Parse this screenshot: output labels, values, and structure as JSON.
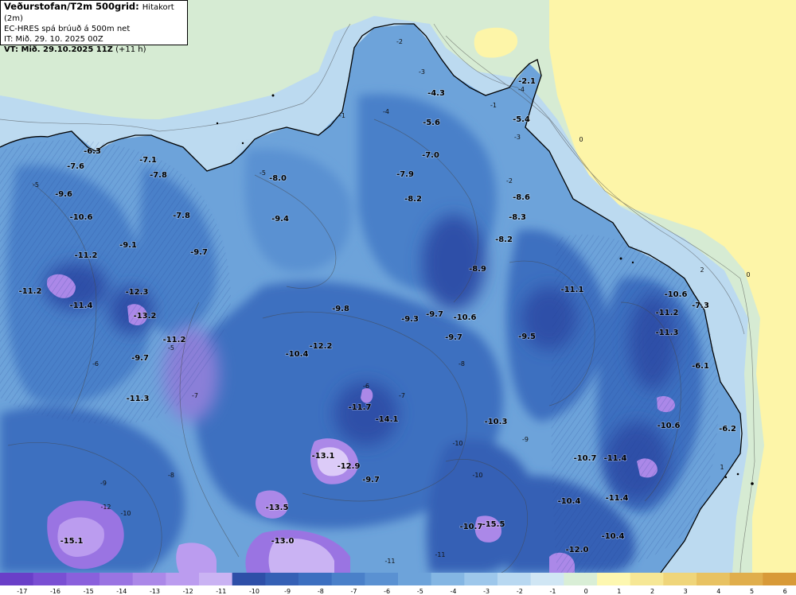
{
  "header": {
    "title": "Veðurstofan/T2m 500grid:",
    "title_sub": "Hitakort (2m)",
    "model_line": "EC-HRES spá brúuð á 500m net",
    "init_line": "IT: Mið. 29. 10. 2025 00Z",
    "valid_bold": "VT: Mið. 29.10.2025 11Z",
    "valid_rest": "(+11 h)"
  },
  "colors": {
    "ocean_sea": "#d6ebd3",
    "coastal_warm": "#fdf5a8",
    "contour_line": "#444444",
    "coastline": "#000000"
  },
  "colorbar": {
    "ticks": [
      "-17",
      "-16",
      "-15",
      "-14",
      "-13",
      "-12",
      "-11",
      "-10",
      "-9",
      "-8",
      "-7",
      "-6",
      "-5",
      "-4",
      "-3",
      "-2",
      "-1",
      "0",
      "1",
      "2",
      "3",
      "4",
      "5",
      "6"
    ],
    "colors": [
      "#6a3fc8",
      "#7a4fd3",
      "#8a60dc",
      "#9a74e2",
      "#ab88e8",
      "#bb9cef",
      "#cab3f3",
      "#2e4fa8",
      "#3560b5",
      "#3c6fc0",
      "#4a80c9",
      "#5a91d2",
      "#6da3da",
      "#84b6e3",
      "#9dc7eb",
      "#b8d8f1",
      "#d0e6f4",
      "#d9eed6",
      "#fdf7b0",
      "#f6e795",
      "#efd57a",
      "#e8c262",
      "#e0ae4c",
      "#d89a38"
    ]
  },
  "temperature_labels": [
    {
      "v": "-6.3"
    },
    {
      "v": "-7.6"
    },
    {
      "v": "-9.6"
    },
    {
      "v": "-10.6"
    },
    {
      "v": "-11.2"
    },
    {
      "v": "-11.2"
    },
    {
      "v": "-11.4"
    },
    {
      "v": "-9.1"
    },
    {
      "v": "-12.3"
    },
    {
      "v": "-13.2"
    },
    {
      "v": "-9.7"
    },
    {
      "v": "-11.3"
    },
    {
      "v": "-7.1"
    },
    {
      "v": "-7.8"
    },
    {
      "v": "-7.8"
    },
    {
      "v": "-9.7"
    },
    {
      "v": "-11.2"
    },
    {
      "v": "-8.0"
    },
    {
      "v": "-9.4"
    },
    {
      "v": "-9.8"
    },
    {
      "v": "-12.2"
    },
    {
      "v": "-10.4"
    },
    {
      "v": "-11.7"
    },
    {
      "v": "-14.1"
    },
    {
      "v": "-13.1"
    },
    {
      "v": "-12.9"
    },
    {
      "v": "-9.7"
    },
    {
      "v": "-13.5"
    },
    {
      "v": "-13.0"
    },
    {
      "v": "-15.1"
    },
    {
      "v": "-4.3"
    },
    {
      "v": "-5.6"
    },
    {
      "v": "-7.0"
    },
    {
      "v": "-7.9"
    },
    {
      "v": "-8.2"
    },
    {
      "v": "-2.1"
    },
    {
      "v": "-5.4"
    },
    {
      "v": "-8.6"
    },
    {
      "v": "-8.3"
    },
    {
      "v": "-8.2"
    },
    {
      "v": "-8.9"
    },
    {
      "v": "-9.3"
    },
    {
      "v": "-9.7"
    },
    {
      "v": "-10.6"
    },
    {
      "v": "-9.7"
    },
    {
      "v": "-9.5"
    },
    {
      "v": "-11.1"
    },
    {
      "v": "-10.6"
    },
    {
      "v": "-7.3"
    },
    {
      "v": "-11.2"
    },
    {
      "v": "-11.3"
    },
    {
      "v": "-6.1"
    },
    {
      "v": "-10.6"
    },
    {
      "v": "-6.2"
    },
    {
      "v": "-10.3"
    },
    {
      "v": "-10.7"
    },
    {
      "v": "-11.4"
    },
    {
      "v": "-10.4"
    },
    {
      "v": "-11.4"
    },
    {
      "v": "-10.7"
    },
    {
      "v": "-15.5"
    },
    {
      "v": "-10.4"
    },
    {
      "v": "-12.0"
    }
  ],
  "contour_labels": [
    "-2",
    "-3",
    "-4",
    "-5",
    "-1",
    "-1",
    "0",
    "0",
    "1",
    "2",
    "-5",
    "-6",
    "-7",
    "-8",
    "-9",
    "-10",
    "-12",
    "-11",
    "-6",
    "-7",
    "-8",
    "-10",
    "-5",
    "-4",
    "-3",
    "-2",
    "-9",
    "-10",
    "-11"
  ]
}
